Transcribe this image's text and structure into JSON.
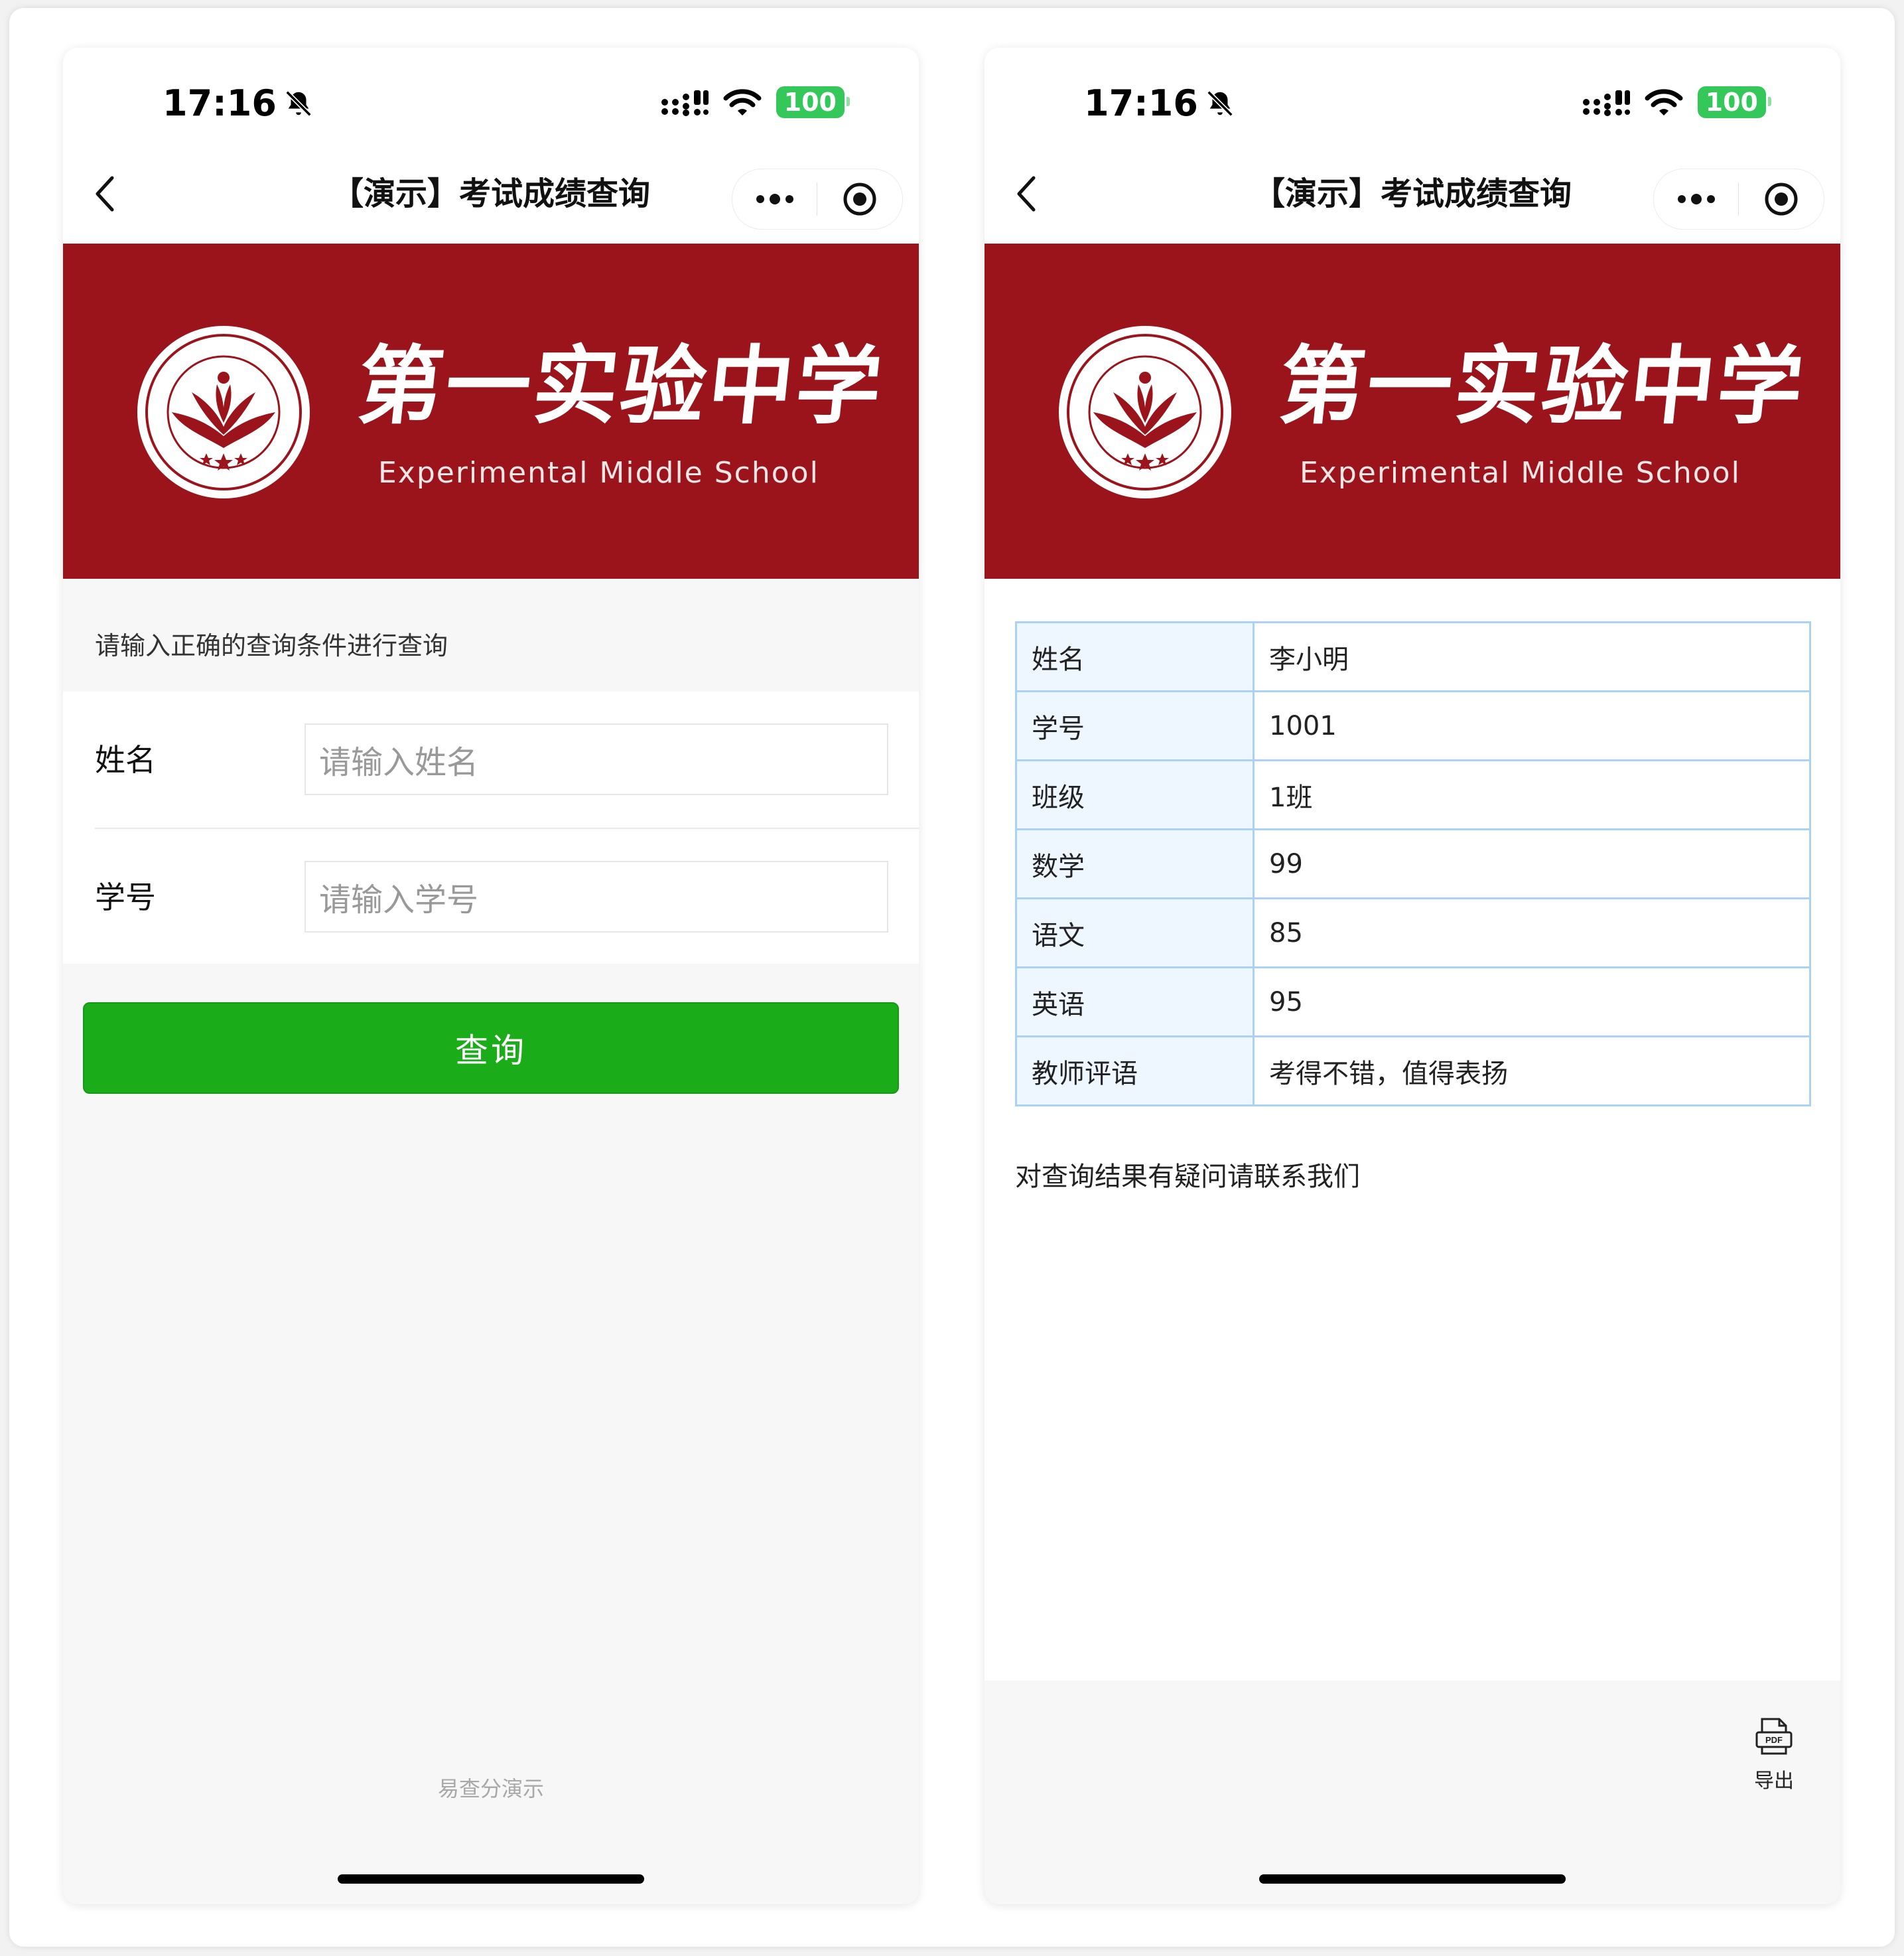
{
  "status": {
    "time": "17:16",
    "battery": "100"
  },
  "nav": {
    "title": "【演示】考试成绩查询"
  },
  "banner": {
    "school_cn": "第一实验中学",
    "school_en": "Experimental Middle School"
  },
  "query_page": {
    "hint": "请输入正确的查询条件进行查询",
    "fields": [
      {
        "label": "姓名",
        "placeholder": "请输入姓名"
      },
      {
        "label": "学号",
        "placeholder": "请输入学号"
      }
    ],
    "button": "查询",
    "footer": "易查分演示"
  },
  "result_page": {
    "rows": [
      {
        "key": "姓名",
        "value": "李小明"
      },
      {
        "key": "学号",
        "value": "1001"
      },
      {
        "key": "班级",
        "value": "1班"
      },
      {
        "key": "数学",
        "value": "99"
      },
      {
        "key": "语文",
        "value": "85"
      },
      {
        "key": "英语",
        "value": "95"
      },
      {
        "key": "教师评语",
        "value": "考得不错，值得表扬"
      }
    ],
    "contact": "对查询结果有疑问请联系我们",
    "export_label": "导出",
    "export_icon_text": "PDF"
  },
  "colors": {
    "banner": "#9b141b",
    "primary_button": "#1aad19",
    "table_border": "#aad2f4",
    "table_key_bg": "#eef7ff",
    "battery": "#34c759"
  }
}
